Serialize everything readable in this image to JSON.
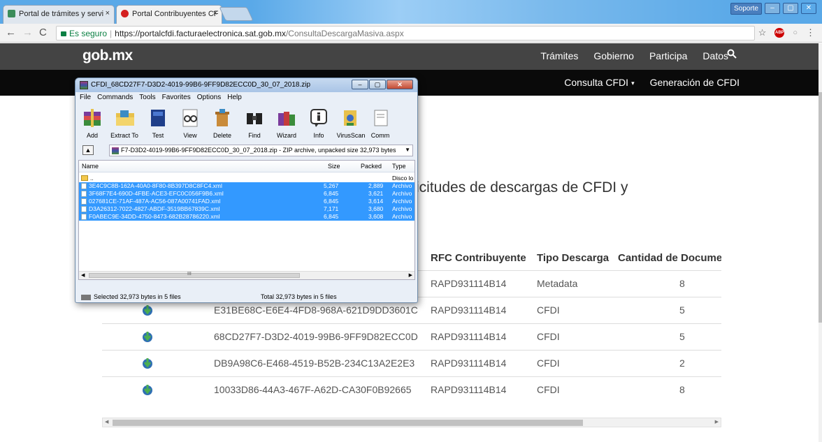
{
  "browser": {
    "tabs": [
      {
        "label": "Portal de trámites y servi",
        "close": "×",
        "active": false
      },
      {
        "label": "Portal Contribuyentes CF",
        "close": "×",
        "active": true
      }
    ],
    "soporte_label": "Soporte",
    "secure_label": "Es seguro",
    "url_protocol_host": "https://portalcfdi.facturaelectronica.sat.gob.mx",
    "url_path": "/ConsultaDescargaMasiva.aspx",
    "star": "☆",
    "abp": "ABP"
  },
  "gob": {
    "logo": "gob.mx",
    "nav": [
      "Trámites",
      "Gobierno",
      "Participa",
      "Datos"
    ],
    "subnav": [
      {
        "label": "Consulta CFDI",
        "caret": "▾"
      },
      {
        "label": "Generación de CFDI"
      }
    ]
  },
  "page": {
    "heading": "icitudes de descargas de CFDI y",
    "columns": [
      "RFC Contribuyente",
      "Tipo Descarga",
      "Cantidad de Documento"
    ],
    "rows": [
      {
        "folio": "",
        "rfc": "RAPD931114B14",
        "tipo": "Metadata",
        "cantidad": "8"
      },
      {
        "folio": "E31BE68C-E6E4-4FD8-968A-621D9DD3601C",
        "rfc": "RAPD931114B14",
        "tipo": "CFDI",
        "cantidad": "5"
      },
      {
        "folio": "68CD27F7-D3D2-4019-99B6-9FF9D82ECC0D",
        "rfc": "RAPD931114B14",
        "tipo": "CFDI",
        "cantidad": "5"
      },
      {
        "folio": "DB9A98C6-E468-4519-B52B-234C13A2E2E3",
        "rfc": "RAPD931114B14",
        "tipo": "CFDI",
        "cantidad": "2"
      },
      {
        "folio": "10033D86-44A3-467F-A62D-CA30F0B92665",
        "rfc": "RAPD931114B14",
        "tipo": "CFDI",
        "cantidad": "8"
      }
    ]
  },
  "winrar": {
    "title": "CFDI_68CD27F7-D3D2-4019-99B6-9FF9D82ECC0D_30_07_2018.zip",
    "menu": [
      "File",
      "Commands",
      "Tools",
      "Favorites",
      "Options",
      "Help"
    ],
    "tools": [
      "Add",
      "Extract To",
      "Test",
      "View",
      "Delete",
      "Find",
      "Wizard",
      "Info",
      "VirusScan",
      "Comm"
    ],
    "path": "F7-D3D2-4019-99B6-9FF9D82ECC0D_30_07_2018.zip - ZIP archive, unpacked size 32,973 bytes",
    "list_headers": [
      "Name",
      "Size",
      "Packed",
      "Type"
    ],
    "parent_row": {
      "name": "..",
      "type": "Disco lo"
    },
    "files": [
      {
        "name": "3E4C9C8B-162A-40A0-8F80-8B397D8C8FC4.xml",
        "size": "5,267",
        "packed": "2,889",
        "type": "Archivo"
      },
      {
        "name": "3F68F7E4-690D-4FBE-ACE3-EFC0C056F9B6.xml",
        "size": "6,845",
        "packed": "3,621",
        "type": "Archivo"
      },
      {
        "name": "027681CE-71AF-487A-AC56-087A00741FAD.xml",
        "size": "6,845",
        "packed": "3,614",
        "type": "Archivo"
      },
      {
        "name": "D3A26312-7022-4827-ABDF-3519BB67839C.xml",
        "size": "7,171",
        "packed": "3,680",
        "type": "Archivo"
      },
      {
        "name": "F0ABEC9E-34DD-4750-8473-682B28786220.xml",
        "size": "6,845",
        "packed": "3,608",
        "type": "Archivo"
      }
    ],
    "status_selected": "Selected 32,973 bytes in 5 files",
    "status_total": "Total 32,973 bytes in 5 files",
    "scroll_mark": "III"
  }
}
